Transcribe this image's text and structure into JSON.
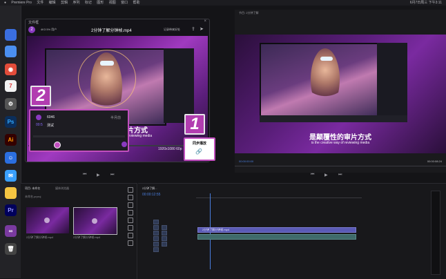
{
  "menubar": {
    "app": "Premiere Pro",
    "items": [
      "文件",
      "编辑",
      "剪辑",
      "序列",
      "标记",
      "图形",
      "视图",
      "窗口",
      "帮助"
    ],
    "clock": "6月7日周三 下午3:11"
  },
  "modal": {
    "title": "文件框",
    "step_label": "2",
    "left_label": "4K3  5% 用户",
    "filename": "2分钟了解分钟帧.mp4",
    "action_label": "记录带来好处",
    "resolution": "1920x1080 60p"
  },
  "card": {
    "row1_id": "6046",
    "row1_time": "半月前",
    "row2_label": "测试",
    "row2_prefix": "00:5"
  },
  "sync": {
    "button_label": "同步播放",
    "badge_number": "1"
  },
  "program": {
    "caption": "是颠覆性的审片方式",
    "subcaption": "is the creative way of reviewing media",
    "modal_caption": "片方式",
    "modal_subcaption": "reviewing media",
    "timecode_left": "00:00:00:00",
    "timecode_right": "00:00:08:24"
  },
  "project": {
    "tab1": "项目: 未命名",
    "tab2": "媒体浏览器",
    "folder": "未命名.prproj",
    "item1": "2分钟了解分钟帧.mp4",
    "item2": "2分钟了解分钟帧.mp4"
  },
  "timeline": {
    "tab": "2分钟了解...",
    "timecode": "00:00:12:55",
    "clip_label": "2分钟了解分钟帧.mp4"
  },
  "colors": {
    "accent": "#c24fbf",
    "badge": "#b23db0"
  }
}
